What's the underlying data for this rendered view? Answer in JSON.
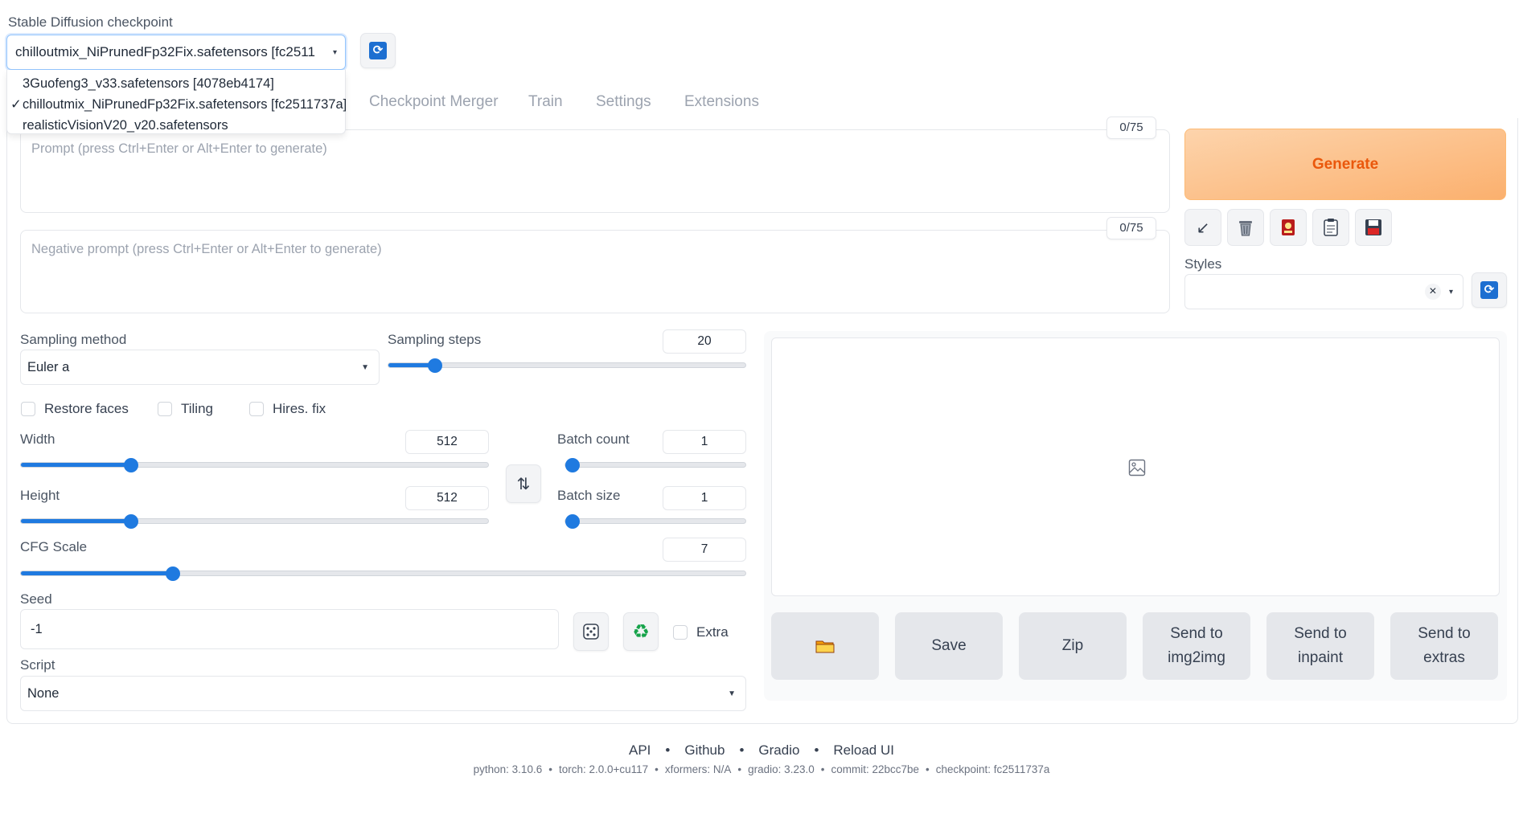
{
  "checkpoint": {
    "label": "Stable Diffusion checkpoint",
    "selected": "chilloutmix_NiPrunedFp32Fix.safetensors [fc2511",
    "options": [
      {
        "label": "3Guofeng3_v33.safetensors [4078eb4174]",
        "checked": false
      },
      {
        "label": "chilloutmix_NiPrunedFp32Fix.safetensors [fc2511737a]",
        "checked": true
      },
      {
        "label": "realisticVisionV20_v20.safetensors",
        "checked": false
      }
    ],
    "check_mark": "✓"
  },
  "tabs": [
    "Checkpoint Merger",
    "Train",
    "Settings",
    "Extensions"
  ],
  "prompt": {
    "placeholder": "Prompt (press Ctrl+Enter or Alt+Enter to generate)",
    "tokens": "0/75"
  },
  "negative_prompt": {
    "placeholder": "Negative prompt (press Ctrl+Enter or Alt+Enter to generate)",
    "tokens": "0/75"
  },
  "generate_label": "Generate",
  "tool_icons": [
    "arrow-diagonal-icon",
    "trash-icon",
    "red-card-icon",
    "clipboard-icon",
    "save-disk-icon"
  ],
  "styles": {
    "label": "Styles",
    "clear": "×"
  },
  "sampling": {
    "method_label": "Sampling method",
    "method": "Euler a",
    "steps_label": "Sampling steps",
    "steps": "20",
    "steps_fraction": 0.13
  },
  "checkboxes": {
    "restore_faces": "Restore faces",
    "tiling": "Tiling",
    "hires_fix": "Hires. fix"
  },
  "width": {
    "label": "Width",
    "value": "512",
    "fraction": 0.235
  },
  "height": {
    "label": "Height",
    "value": "512",
    "fraction": 0.235
  },
  "batch_count": {
    "label": "Batch count",
    "value": "1",
    "fraction": 0.0
  },
  "batch_size": {
    "label": "Batch size",
    "value": "1",
    "fraction": 0.0
  },
  "cfg": {
    "label": "CFG Scale",
    "value": "7",
    "fraction": 0.21
  },
  "seed": {
    "label": "Seed",
    "value": "-1",
    "extra_label": "Extra"
  },
  "script": {
    "label": "Script",
    "value": "None"
  },
  "output_buttons": [
    {
      "name": "open-folder-button",
      "label": ""
    },
    {
      "name": "save-button",
      "label": "Save"
    },
    {
      "name": "zip-button",
      "label": "Zip"
    },
    {
      "name": "send-to-img2img-button",
      "label": "Send to img2img"
    },
    {
      "name": "send-to-inpaint-button",
      "label": "Send to inpaint"
    },
    {
      "name": "send-to-extras-button",
      "label": "Send to extras"
    }
  ],
  "footer": {
    "links": [
      "API",
      "Github",
      "Gradio",
      "Reload UI"
    ],
    "info": [
      "python: 3.10.6",
      "torch: 2.0.0+cu117",
      "xformers: N/A",
      "gradio: 3.23.0",
      "commit: 22bcc7be",
      "checkpoint: fc2511737a"
    ],
    "separator": "•"
  },
  "colors": {
    "accent": "#1f7ae0",
    "generate_text": "#ea580c",
    "generate_bg": "#fbb06e"
  }
}
